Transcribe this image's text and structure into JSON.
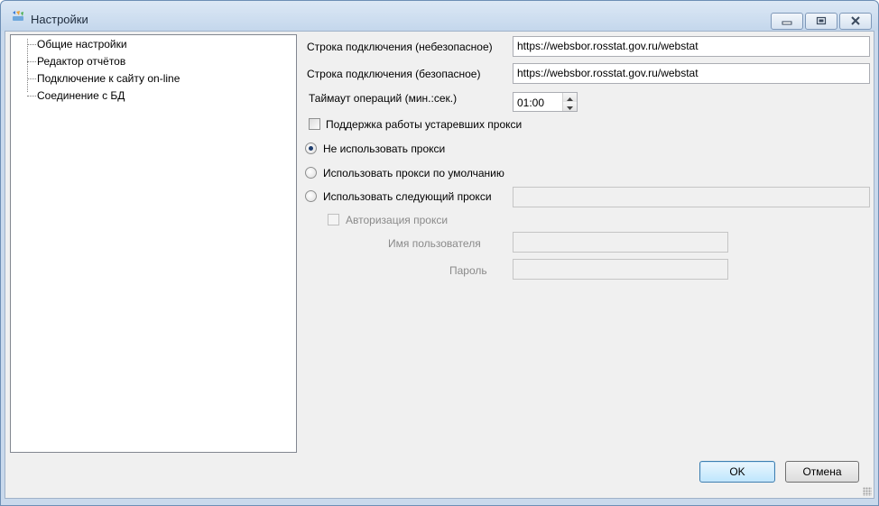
{
  "window": {
    "title": "Настройки",
    "icon": "settings-app-icon"
  },
  "tree": {
    "items": [
      {
        "label": "Общие настройки"
      },
      {
        "label": "Редактор отчётов"
      },
      {
        "label": "Подключение к сайту on-line"
      },
      {
        "label": "Соединение с БД"
      }
    ]
  },
  "form": {
    "conn_insecure_label": "Строка подключения (небезопасное)",
    "conn_insecure_value": "https://websbor.rosstat.gov.ru/webstat",
    "conn_secure_label": "Строка подключения (безопасное)",
    "conn_secure_value": "https://websbor.rosstat.gov.ru/webstat",
    "timeout_label": "Таймаут операций (мин.:сек.)",
    "timeout_value": "01:00",
    "legacy_proxy_label": "Поддержка работы устаревших прокси",
    "proxy_none_label": "Не использовать прокси",
    "proxy_default_label": "Использовать прокси по умолчанию",
    "proxy_custom_label": "Использовать следующий прокси",
    "proxy_custom_value": "",
    "proxy_auth_label": "Авторизация прокси",
    "username_label": "Имя пользователя",
    "username_value": "",
    "password_label": "Пароль",
    "password_value": ""
  },
  "buttons": {
    "ok": "OK",
    "cancel": "Отмена"
  },
  "state": {
    "legacy_proxy_checked": false,
    "proxy_mode": "none",
    "proxy_auth_checked": false
  }
}
